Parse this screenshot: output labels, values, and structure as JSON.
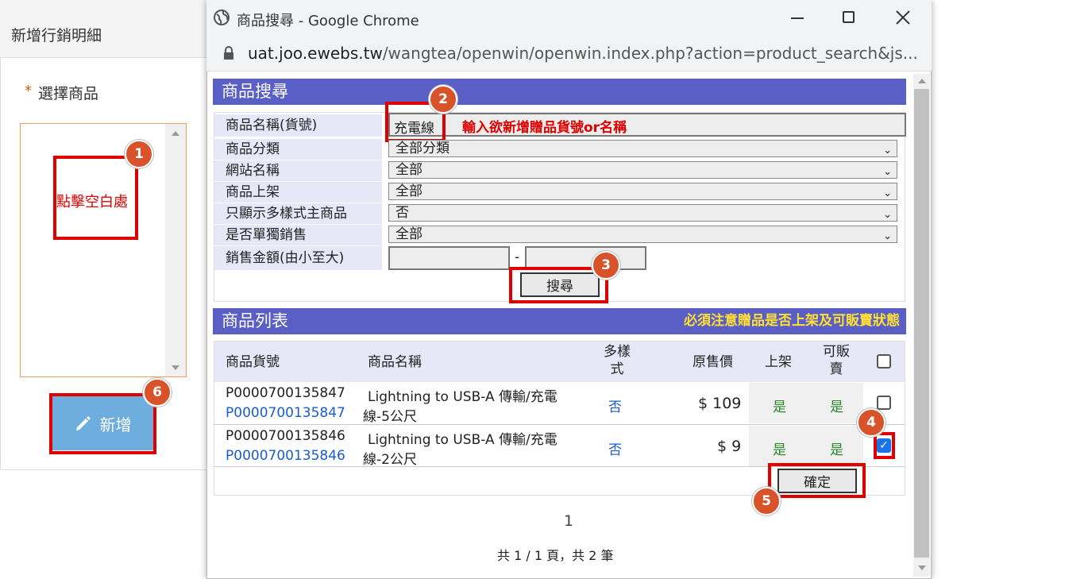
{
  "left": {
    "title": "新增行銷明細",
    "required_mark": "*",
    "select_label": "選擇商品",
    "hint": "點擊空白處",
    "add_button": "新增"
  },
  "window": {
    "title": "商品搜尋 - Google Chrome",
    "url_host": "uat.joo.ewebs.tw",
    "url_path": "/wangtea/openwin/openwin.index.php?action=product_search&js..."
  },
  "search": {
    "section_title": "商品搜尋",
    "fields": [
      {
        "label": "商品名稱(貨號)",
        "value": "充電線"
      },
      {
        "label": "商品分類",
        "value": "全部分類"
      },
      {
        "label": "網站名稱",
        "value": "全部"
      },
      {
        "label": "商品上架",
        "value": "全部"
      },
      {
        "label": "只顯示多樣式主商品",
        "value": "否"
      },
      {
        "label": "是否單獨銷售",
        "value": "全部"
      },
      {
        "label": "銷售金額(由小至大)",
        "value": ""
      }
    ],
    "name_hint": "輸入欲新增贈品貨號or名稱",
    "range_separator": "-",
    "search_button": "搜尋"
  },
  "list": {
    "section_title": "商品列表",
    "notice": "必須注意贈品是否上架及可販賣狀態",
    "headers": {
      "sku": "商品貨號",
      "name": "商品名稱",
      "multi_1": "多樣",
      "multi_2": "式",
      "price": "原售價",
      "listed": "上架",
      "sellable_1": "可販",
      "sellable_2": "賣"
    },
    "rows": [
      {
        "sku": "P0000700135847",
        "sku_link": "P0000700135847",
        "name_1": "Lightning to USB-A 傳輸/充電",
        "name_2": "線-5公尺",
        "multi": "否",
        "price": "$ 109",
        "listed": "是",
        "sellable": "是",
        "checked": false
      },
      {
        "sku": "P0000700135846",
        "sku_link": "P0000700135846",
        "name_1": "Lightning to USB-A 傳輸/充電",
        "name_2": "線-2公尺",
        "multi": "否",
        "price": "$ 9",
        "listed": "是",
        "sellable": "是",
        "checked": true
      }
    ],
    "confirm_button": "確定",
    "page_number": "1",
    "summary": "共 1 / 1 頁，共 2 筆"
  },
  "annotations": [
    "1",
    "2",
    "3",
    "4",
    "5",
    "6"
  ],
  "colors": {
    "accent": "#5a5fc6",
    "highlight": "#e00000",
    "badge": "#d9532a",
    "button": "#6eaede",
    "notice": "#ffe033"
  }
}
